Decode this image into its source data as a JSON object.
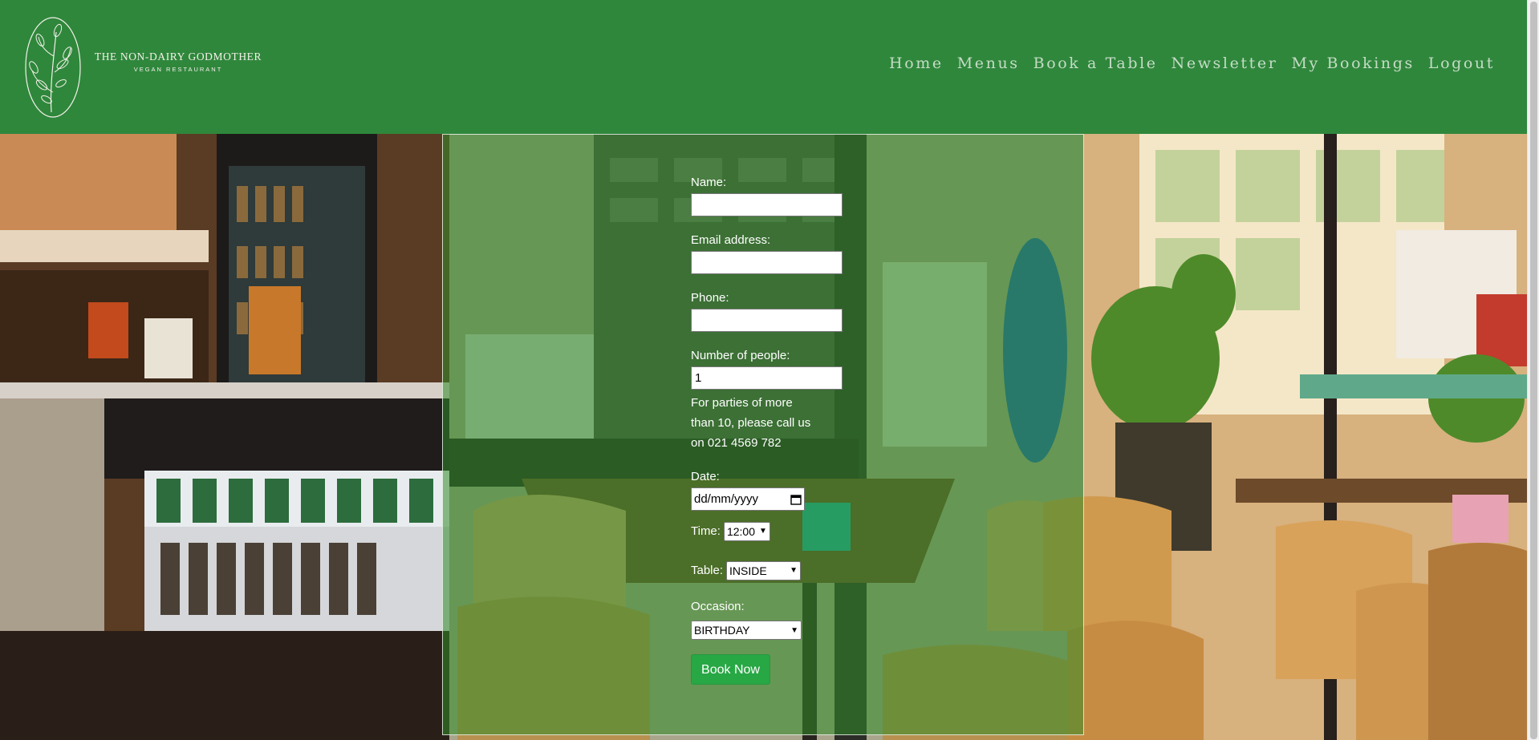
{
  "brand": {
    "name": "THE NON-DAIRY GODMOTHER",
    "tagline": "VEGAN RESTAURANT"
  },
  "nav": [
    "Home",
    "Menus",
    "Book a Table",
    "Newsletter",
    "My Bookings",
    "Logout"
  ],
  "form": {
    "name_label": "Name:",
    "name_value": "",
    "email_label": "Email address:",
    "email_value": "",
    "phone_label": "Phone:",
    "phone_value": "",
    "people_label": "Number of people:",
    "people_value": "1",
    "people_note": "For parties of more than 10, please call us on 021 4569 782",
    "date_label": "Date:",
    "date_placeholder": "dd/mm/yyyy",
    "time_label": "Time:",
    "time_selected": "12:00",
    "table_label": "Table:",
    "table_selected": "INSIDE",
    "occasion_label": "Occasion:",
    "occasion_selected": "BIRTHDAY",
    "submit_label": "Book Now"
  },
  "colors": {
    "header_bg": "#2f873c",
    "nav_text": "#c6dcc6",
    "panel_tint": "rgba(50,140,40,0.55)",
    "button_bg": "#28a745"
  },
  "icons": {
    "logo": "botanical-leaf-logo",
    "date": "calendar-icon",
    "select": "chevron-down-icon"
  }
}
